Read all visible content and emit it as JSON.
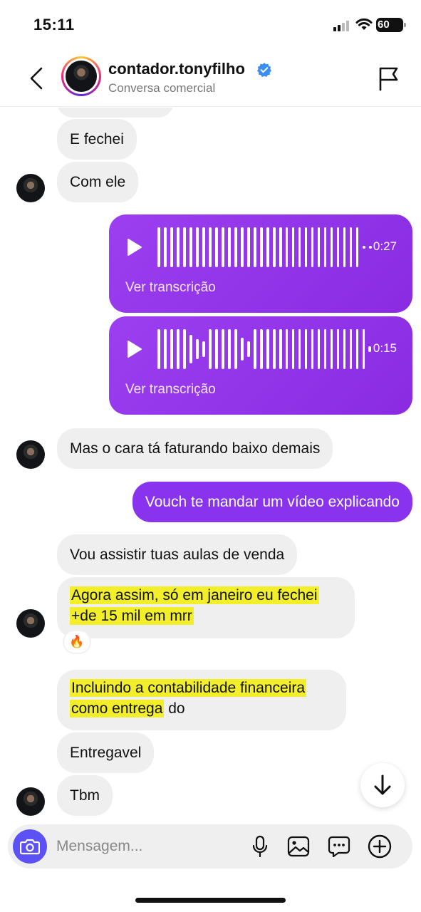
{
  "status_bar": {
    "time": "15:11",
    "battery": "60"
  },
  "header": {
    "username": "contador.tonyfilho",
    "subtitle": "Conversa comercial",
    "verified": true
  },
  "messages": {
    "m0": "E fechei",
    "m1": "Com ele",
    "audio1": {
      "duration": "0:27",
      "transcript_label": "Ver transcrição"
    },
    "audio2": {
      "duration": "0:15",
      "transcript_label": "Ver transcrição"
    },
    "m2": "Mas o cara tá faturando baixo demais",
    "m3": "Vouch te mandar um vídeo explicando",
    "m4": "Vou assistir tuas aulas de venda",
    "m5_line1": "Agora assim, só em janeiro eu fechei",
    "m5_line2": "+de 15 mil em mrr",
    "m5_reaction": "🔥",
    "m6_line1": "Incluindo a contabilidade financeira",
    "m6_line2_hl": "como entrega",
    "m6_line2_rest": " do",
    "m7": "Entregavel",
    "m8": "Tbm"
  },
  "composer": {
    "placeholder": "Mensagem..."
  },
  "colors": {
    "outgoing": "#8a33ee",
    "incoming": "#efefef",
    "highlight": "#f2ef2a",
    "camera": "#5b51f5"
  },
  "icons": [
    "back-arrow-icon",
    "verified-badge-icon",
    "flag-icon",
    "play-icon",
    "arrow-down-icon",
    "camera-icon",
    "microphone-icon",
    "image-icon",
    "chat-bubble-icon",
    "plus-circle-icon"
  ]
}
